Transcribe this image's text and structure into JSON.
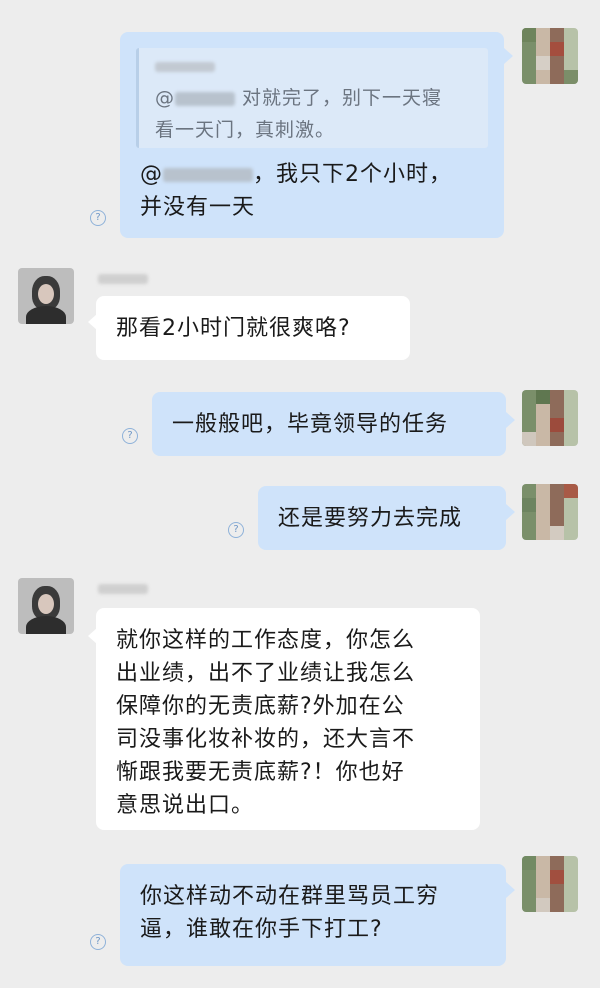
{
  "messages": [
    {
      "sender": "self",
      "quote": {
        "line1_prefix": "@",
        "line1_text": "对就完了，别下一天寝",
        "line2_text": "看一天门，真刺激。"
      },
      "prefix": "@",
      "text_line1": "，我只下2个小时，",
      "text_line2": "并没有一天",
      "read_marker": "?"
    },
    {
      "sender": "other",
      "text": "那看2小时门就很爽咯?"
    },
    {
      "sender": "self",
      "text": "一般般吧，毕竟领导的任务",
      "read_marker": "?"
    },
    {
      "sender": "self",
      "text": "还是要努力去完成",
      "read_marker": "?"
    },
    {
      "sender": "other",
      "lines": [
        "就你这样的工作态度，你怎么",
        "出业绩，出不了业绩让我怎么",
        "保障你的无责底薪?外加在公",
        "司没事化妆补妆的，还大言不",
        "惭跟我要无责底薪?！你也好",
        "意思说出口。"
      ]
    },
    {
      "sender": "self",
      "lines": [
        "你这样动不动在群里骂员工穷",
        "逼，谁敢在你手下打工?"
      ],
      "read_marker": "?"
    }
  ],
  "colors": {
    "self_bubble": "#cfe3fa",
    "other_bubble": "#ffffff",
    "background": "#ededed"
  },
  "icons": {
    "read_marker": "read-status-icon",
    "avatar_self": "avatar",
    "avatar_other": "avatar"
  }
}
